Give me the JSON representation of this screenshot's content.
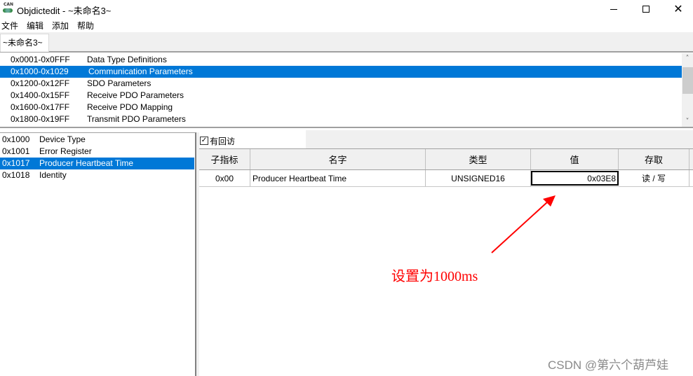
{
  "window": {
    "title": "Objdictedit - ~未命名3~",
    "app_icon": "can-open-icon",
    "controls": {
      "minimize": "minimize-icon",
      "maximize": "maximize-icon",
      "close": "close-icon",
      "close_glyph": "✕"
    }
  },
  "menu": [
    "文件",
    "编辑",
    "添加",
    "帮助"
  ],
  "tabs": [
    {
      "label": "~未命名3~",
      "active": true
    }
  ],
  "range_list": {
    "selected_index": 1,
    "items": [
      {
        "range": "0x0001-0x0FFF",
        "label": "Data Type Definitions"
      },
      {
        "range": "0x1000-0x1029",
        "label": "Communication Parameters"
      },
      {
        "range": "0x1200-0x12FF",
        "label": "SDO Parameters"
      },
      {
        "range": "0x1400-0x15FF",
        "label": "Receive PDO Parameters"
      },
      {
        "range": "0x1600-0x17FF",
        "label": "Receive PDO Mapping"
      },
      {
        "range": "0x1800-0x19FF",
        "label": "Transmit PDO Parameters"
      }
    ],
    "scroll_up_glyph": "˄",
    "scroll_down_glyph": "˅"
  },
  "index_list": {
    "selected_index": 2,
    "items": [
      {
        "index": "0x1000",
        "name": "Device Type"
      },
      {
        "index": "0x1001",
        "name": "Error Register"
      },
      {
        "index": "0x1017",
        "name": "Producer Heartbeat Time"
      },
      {
        "index": "0x1018",
        "name": "Identity"
      }
    ]
  },
  "callback_checkbox": {
    "label": "有回访",
    "checked": true,
    "glyph": "✓"
  },
  "grid": {
    "headers": [
      "子指标",
      "名字",
      "类型",
      "值",
      "存取"
    ],
    "rows": [
      {
        "subindex": "0x00",
        "name": "Producer Heartbeat Time",
        "type": "UNSIGNED16",
        "value": "0x03E8",
        "access": "读 / 写"
      }
    ]
  },
  "annotation": {
    "text": "设置为1000ms",
    "color": "#ff0000"
  },
  "watermark": "CSDN @第六个葫芦娃",
  "colors": {
    "selection": "#0078d7"
  }
}
